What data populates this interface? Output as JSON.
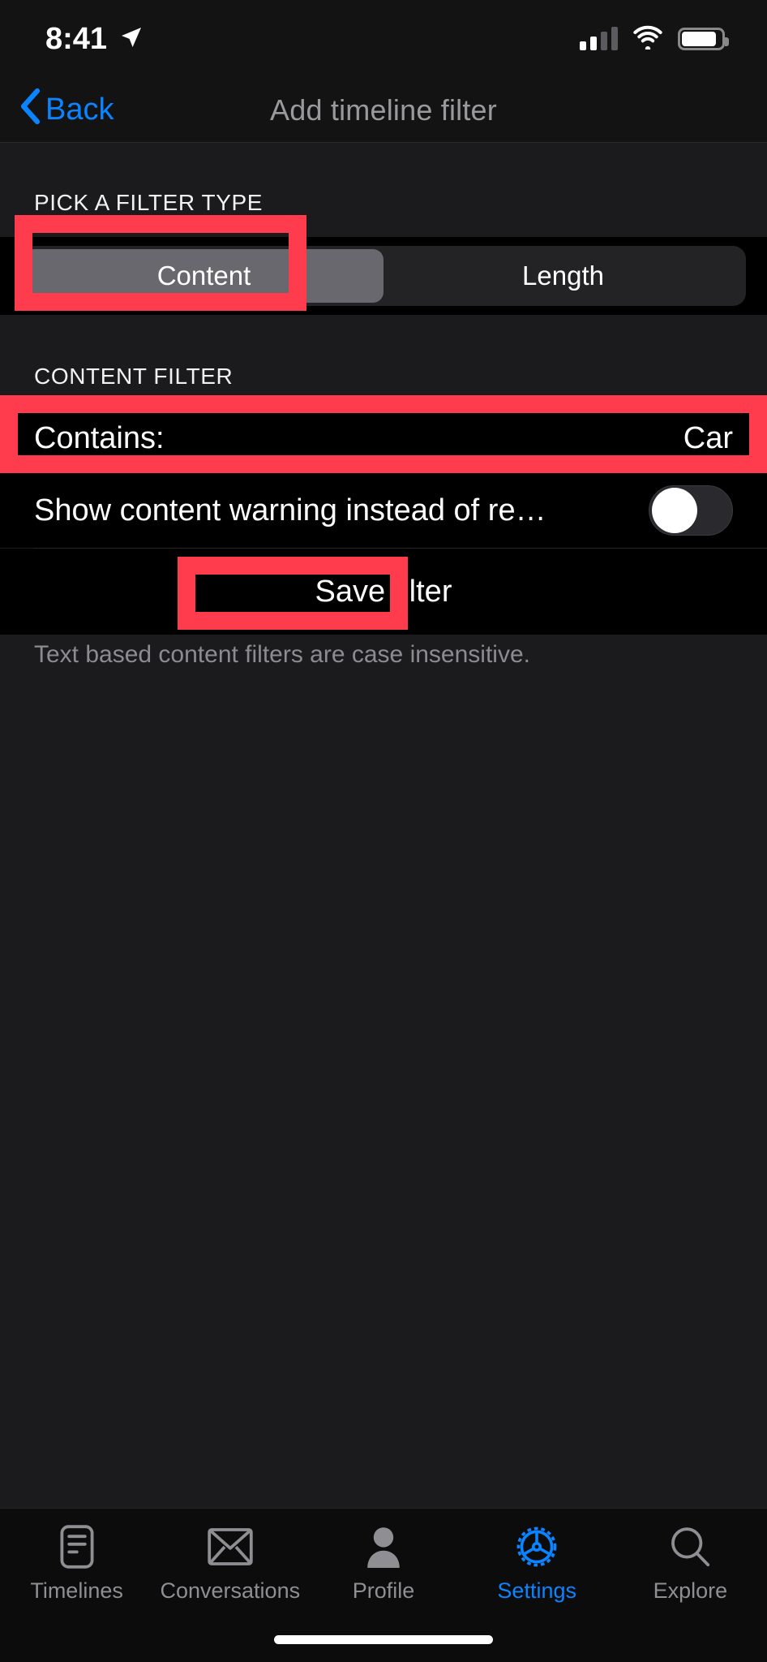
{
  "status_bar": {
    "time": "8:41",
    "location_icon": "location-arrow-icon",
    "cellular_icon": "cellular-bars-icon",
    "cellular_bars_filled": 2,
    "cellular_bars_total": 4,
    "wifi_icon": "wifi-icon",
    "battery_icon": "battery-icon",
    "battery_level_percent": 88
  },
  "nav_bar": {
    "back_label": "Back",
    "back_icon": "chevron-left-icon",
    "title": "Add timeline filter",
    "back_color": "#0a84ff",
    "title_color": "#9a9a9e"
  },
  "filter_type_section": {
    "header": "PICK A FILTER TYPE",
    "segments": [
      {
        "label": "Content",
        "selected": true
      },
      {
        "label": "Length",
        "selected": false
      }
    ],
    "selected_segment": "Content",
    "selected_fill": "#68686e"
  },
  "content_filter_section": {
    "header": "CONTENT FILTER",
    "contains_row": {
      "label": "Contains:",
      "value": "Car"
    },
    "warning_row": {
      "label": "Show content warning instead of re…",
      "toggle_on": false
    },
    "save_button": "Save filter",
    "footnote": "Text based content filters are case insensitive."
  },
  "tab_bar": {
    "active": "Settings",
    "active_color": "#0a84ff",
    "inactive_color": "#8e8e93",
    "tabs": [
      {
        "label": "Timelines",
        "icon": "timelines-document-icon"
      },
      {
        "label": "Conversations",
        "icon": "envelope-icon"
      },
      {
        "label": "Profile",
        "icon": "person-icon"
      },
      {
        "label": "Settings",
        "icon": "gear-icon"
      },
      {
        "label": "Explore",
        "icon": "magnifier-icon"
      }
    ]
  },
  "annotations": {
    "color": "#ff3b4e",
    "boxes": [
      {
        "target": "content-segment"
      },
      {
        "target": "contains-row"
      },
      {
        "target": "save-filter-button"
      }
    ]
  }
}
